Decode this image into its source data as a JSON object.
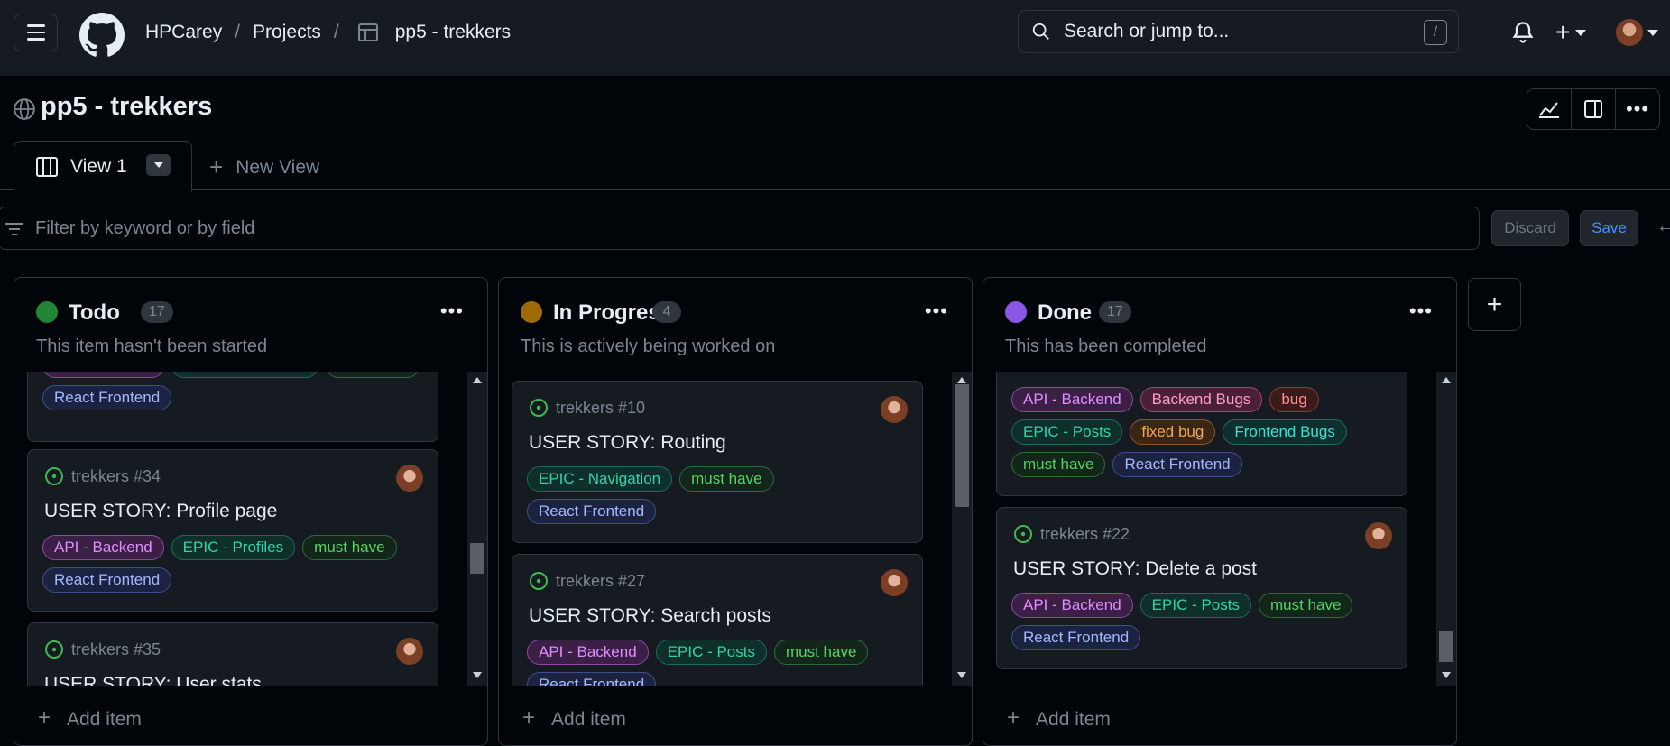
{
  "header": {
    "breadcrumb": [
      "HPCarey",
      "Projects",
      "pp5 - trekkers"
    ],
    "search_placeholder": "Search or jump to...",
    "search_shortcut": "/"
  },
  "project": {
    "title": "pp5 - trekkers",
    "tabs": [
      {
        "label": "View 1"
      },
      {
        "label": "New View"
      }
    ],
    "filter_placeholder": "Filter by keyword or by field",
    "discard_label": "Discard",
    "save_label": "Save"
  },
  "label_colors": {
    "API - Backend": {
      "fg": "#e08cff",
      "bg": "#3b1f45",
      "border": "#8a4aa3"
    },
    "EPIC - Comments": {
      "fg": "#2dd4a7",
      "bg": "#0f2f2a",
      "border": "#1c6b5a"
    },
    "EPIC - Profiles": {
      "fg": "#2dd4a7",
      "bg": "#0f2f2a",
      "border": "#1c6b5a"
    },
    "EPIC - Navigation": {
      "fg": "#2dd4a7",
      "bg": "#0f2f2a",
      "border": "#1c6b5a"
    },
    "EPIC - Posts": {
      "fg": "#2dd4a7",
      "bg": "#0f2f2a",
      "border": "#1c6b5a"
    },
    "must have": {
      "fg": "#56d364",
      "bg": "#12261a",
      "border": "#2e6b3a"
    },
    "React Frontend": {
      "fg": "#a5b8ff",
      "bg": "#1c2340",
      "border": "#3d4e8a"
    },
    "Backend Bugs": {
      "fg": "#ff9bce",
      "bg": "#4a2036",
      "border": "#9b4772"
    },
    "bug": {
      "fg": "#ff8e8e",
      "bg": "#3b1a1a",
      "border": "#8a3a3a"
    },
    "fixed bug": {
      "fg": "#f0a658",
      "bg": "#3a2614",
      "border": "#8a5a2a"
    },
    "Frontend Bugs": {
      "fg": "#3ce0d0",
      "bg": "#0f2f2e",
      "border": "#1f6b66"
    }
  },
  "columns": [
    {
      "title": "Todo",
      "count": "17",
      "color": "#238636",
      "description": "This item hasn't been started",
      "add_item": "Add item",
      "cards": [
        {
          "ref": "",
          "title": "",
          "labels": [
            "API - Backend",
            "EPIC - Comments",
            "must have",
            "React Frontend"
          ]
        },
        {
          "ref": "trekkers #34",
          "title": "USER STORY: Profile page",
          "labels": [
            "API - Backend",
            "EPIC - Profiles",
            "must have",
            "React Frontend"
          ]
        },
        {
          "ref": "trekkers #35",
          "title": "USER STORY: User stats",
          "labels": []
        }
      ]
    },
    {
      "title": "In Progress",
      "count": "4",
      "color": "#9e6a03",
      "description": "This is actively being worked on",
      "add_item": "Add item",
      "cards": [
        {
          "ref": "trekkers #10",
          "title": "USER STORY: Routing",
          "labels": [
            "EPIC - Navigation",
            "must have",
            "React Frontend"
          ]
        },
        {
          "ref": "trekkers #27",
          "title": "USER STORY: Search posts",
          "labels": [
            "API - Backend",
            "EPIC - Posts",
            "must have",
            "React Frontend"
          ]
        }
      ]
    },
    {
      "title": "Done",
      "count": "17",
      "color": "#8957e5",
      "description": "This has been completed",
      "add_item": "Add item",
      "cards": [
        {
          "ref": "",
          "title": "",
          "labels": [
            "API - Backend",
            "Backend Bugs",
            "bug",
            "EPIC - Posts",
            "fixed bug",
            "Frontend Bugs",
            "must have",
            "React Frontend"
          ]
        },
        {
          "ref": "trekkers #22",
          "title": "USER STORY: Delete a post",
          "labels": [
            "API - Backend",
            "EPIC - Posts",
            "must have",
            "React Frontend"
          ]
        }
      ]
    }
  ]
}
